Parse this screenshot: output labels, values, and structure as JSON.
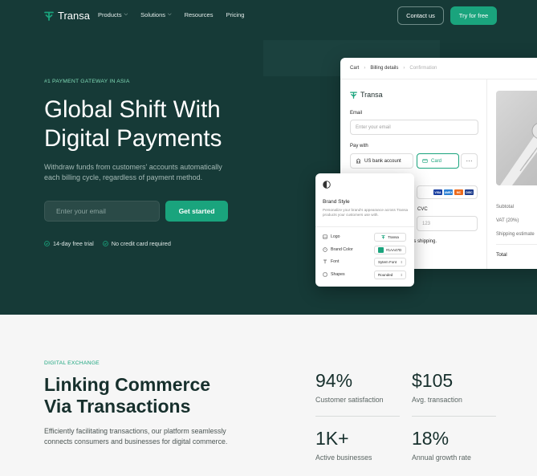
{
  "brand": {
    "name": "Transa",
    "accent": "#1aa47d",
    "hero_bg": "#163a37"
  },
  "nav": {
    "links": [
      {
        "label": "Products",
        "caret": true
      },
      {
        "label": "Solutions",
        "caret": true
      },
      {
        "label": "Resources",
        "caret": false
      },
      {
        "label": "Pricing",
        "caret": false
      }
    ],
    "contact_label": "Contact us",
    "try_label": "Try for free"
  },
  "hero": {
    "eyebrow": "#1 PAYMENT GATEWAY IN ASIA",
    "title_line1": "Global Shift With",
    "title_line2": "Digital Payments",
    "description": "Withdraw funds from customers' accounts automatically each billing cycle, regardless of payment method.",
    "email_placeholder": "Enter your email",
    "cta_label": "Get started",
    "checks": [
      "14-day free trial",
      "No credit card required"
    ]
  },
  "checkout": {
    "breadcrumbs": [
      "Cart",
      "Billing details",
      "Confirmation"
    ],
    "logo": "Transa",
    "email_label": "Email",
    "email_placeholder": "Enter your email",
    "pay_with_label": "Pay with",
    "bank_label": "US bank account",
    "card_label": "Card",
    "more_label": "···",
    "cvc_label": "CVC",
    "cvc_placeholder": "123",
    "shipping_text": "es shipping.",
    "card_brands": [
      "VISA",
      "AMEX",
      "MC",
      "DISC"
    ],
    "summary": {
      "subtotal": "Subtotal",
      "vat": "VAT (20%)",
      "shipping": "Shipping estimate",
      "total": "Total"
    }
  },
  "brand_style": {
    "title": "Brand Style",
    "description": "Personalize your brand's appearance across Transa products your customers use with.",
    "rows": [
      {
        "label": "Logo",
        "value": "Transa",
        "icon": "image-icon"
      },
      {
        "label": "Brand Color",
        "value": "#1AA47D",
        "icon": "palette-icon"
      },
      {
        "label": "Font",
        "value": "Sytem Font",
        "icon": "type-icon"
      },
      {
        "label": "Shapes",
        "value": "Rounded",
        "icon": "shape-icon"
      }
    ]
  },
  "lower": {
    "eyebrow": "DIGITAL EXCHANGE",
    "title_line1": "Linking Commerce",
    "title_line2": "Via Transactions",
    "description": "Efficiently facilitating transactions, our platform seamlessly connects consumers and businesses for digital commerce.",
    "stats": [
      {
        "value": "94%",
        "label": "Customer satisfaction"
      },
      {
        "value": "$105",
        "label": "Avg. transaction"
      },
      {
        "value": "1K+",
        "label": "Active businesses"
      },
      {
        "value": "18%",
        "label": "Annual growth rate"
      }
    ]
  }
}
